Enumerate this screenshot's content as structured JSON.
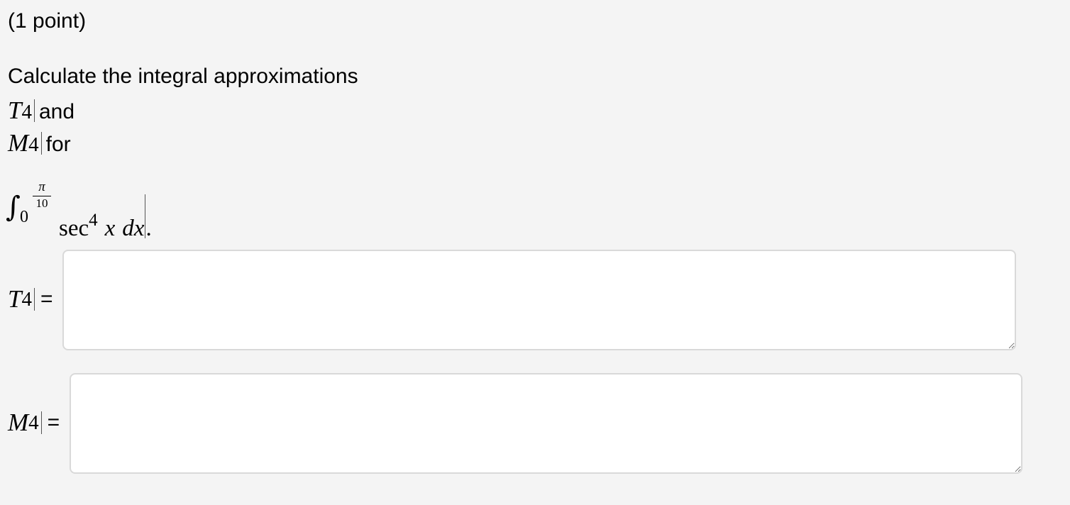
{
  "problem": {
    "points": "(1 point)",
    "intro": "Calculate the integral approximations",
    "t_var": "T",
    "t_sub": "4",
    "t_suffix": "and",
    "m_var": "M",
    "m_sub": "4",
    "m_suffix": "for"
  },
  "integral": {
    "sign": "∫",
    "lower": "0",
    "upper_numerator": "π",
    "upper_denominator": "10",
    "function": "sec",
    "exponent": "4",
    "variable": "x",
    "differential": "dx",
    "terminator": "."
  },
  "answers": [
    {
      "var": "T",
      "sub": "4",
      "equals": "=",
      "value": ""
    },
    {
      "var": "M",
      "sub": "4",
      "equals": "=",
      "value": ""
    }
  ]
}
